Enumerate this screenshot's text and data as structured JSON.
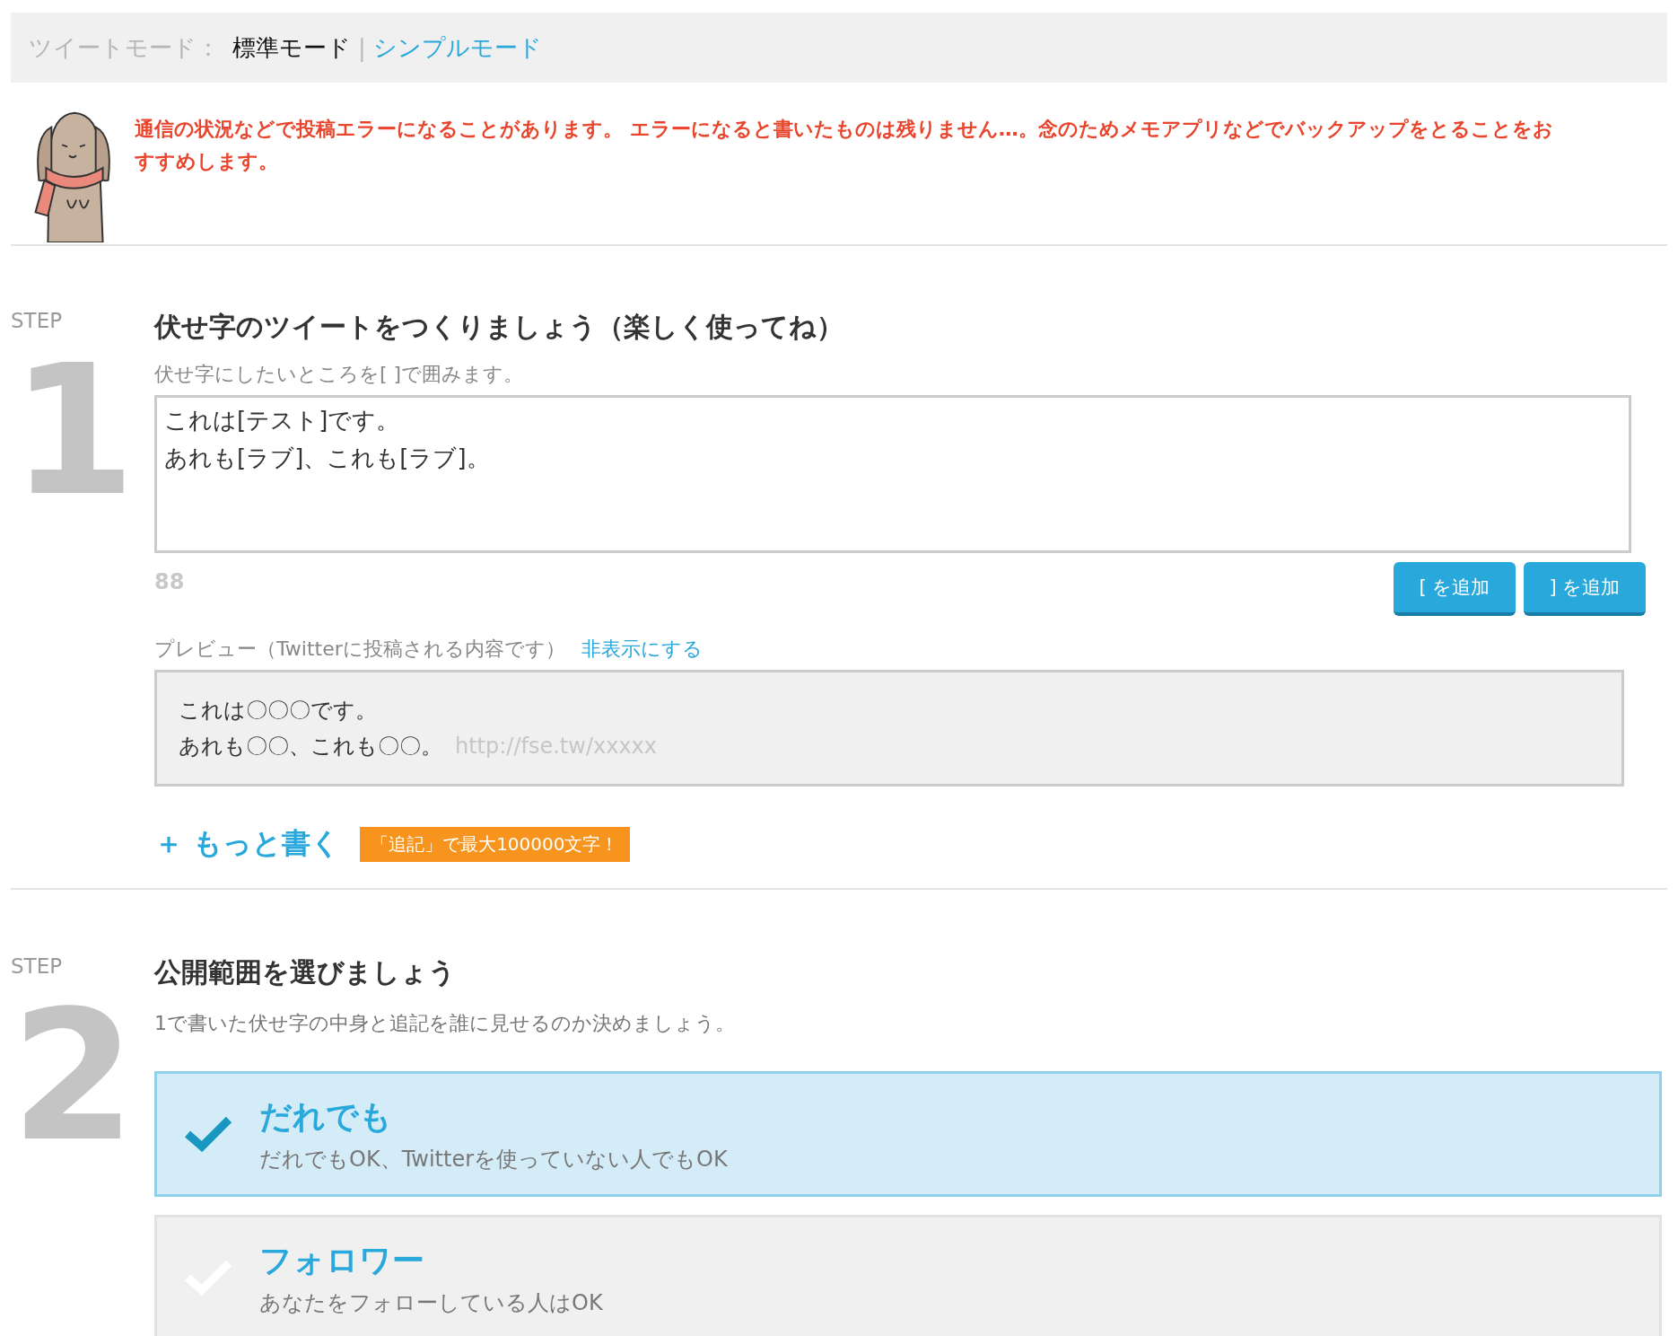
{
  "mode_bar": {
    "label": "ツイートモード：",
    "separator": "|",
    "options": [
      {
        "label": "標準モード",
        "selected": true
      },
      {
        "label": "シンプルモード",
        "selected": false
      }
    ]
  },
  "notice": "通信の状況などで投稿エラーになることがあります。 エラーになると書いたものは残りません…。念のためメモアプリなどでバックアップをとることをおすすめします。",
  "step1": {
    "step_label": "STEP",
    "number": "1",
    "title": "伏せ字のツイートをつくりましょう（楽しく使ってね）",
    "hint": "伏せ字にしたいところを[ ]で囲みます。",
    "text_lines": [
      "これは[テスト]です。",
      "あれも[ラブ]、これも[ラブ]。"
    ],
    "counter": "88",
    "buttons": [
      "[ を追加",
      "] を追加"
    ],
    "preview_label": "プレビュー（Twitterに投稿される内容です）",
    "preview_toggle": "非表示にする",
    "preview_lines": [
      "これは〇〇〇です。",
      "あれも〇〇、これも〇〇。"
    ],
    "preview_url": "http://fse.tw/xxxxx",
    "more_link": "＋ もっと書く",
    "more_tag": "「追記」で最大100000文字！"
  },
  "step2": {
    "step_label": "STEP",
    "number": "2",
    "title": "公開範囲を選びましょう",
    "hint": "1で書いた伏せ字の中身と追記を誰に見せるのか決めましょう。",
    "options": [
      {
        "title": "だれでも",
        "description": "だれでもOK、Twitterを使っていない人でもOK",
        "selected": true
      },
      {
        "title": "フォロワー",
        "description": "あなたをフォローしている人はOK",
        "selected": false
      }
    ]
  }
}
